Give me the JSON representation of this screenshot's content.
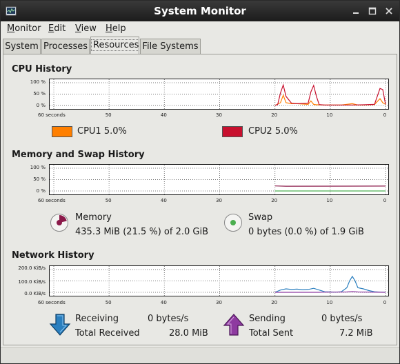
{
  "window": {
    "title": "System Monitor"
  },
  "menu": [
    "Monitor",
    "Edit",
    "View",
    "Help"
  ],
  "tabs": [
    "System",
    "Processes",
    "Resources",
    "File Systems"
  ],
  "active_tab": "Resources",
  "sections": {
    "cpu": {
      "title": "CPU History"
    },
    "memory": {
      "title": "Memory and Swap History"
    },
    "network": {
      "title": "Network History"
    }
  },
  "x_labels": [
    "60 seconds",
    "50",
    "40",
    "30",
    "20",
    "10",
    "0"
  ],
  "percent_labels": [
    "100 %",
    "50 %",
    "0 %"
  ],
  "network_labels": [
    "200.0 KiB/s",
    "100.0 KiB/s",
    "0.0 KiB/s"
  ],
  "cpu_legend": [
    {
      "label": "CPU1",
      "value": "5.0%",
      "color": "#ff7f00"
    },
    {
      "label": "CPU2",
      "value": "5.0%",
      "color": "#c8102e"
    }
  ],
  "memory_info": {
    "memory_label": "Memory",
    "memory_value": "435.3 MiB (21.5 %) of 2.0 GiB",
    "memory_fraction": 0.215,
    "swap_label": "Swap",
    "swap_value": "0 bytes (0.0 %) of 1.9 GiB",
    "swap_fraction": 0.0,
    "memory_color": "#8b1a4a",
    "swap_color": "#4caf50"
  },
  "network_info": {
    "receiving_label": "Receiving",
    "receiving_value": "0 bytes/s",
    "total_received_label": "Total Received",
    "total_received_value": "28.0 MiB",
    "sending_label": "Sending",
    "sending_value": "0 bytes/s",
    "total_sent_label": "Total Sent",
    "total_sent_value": "7.2 MiB",
    "receiving_color": "#2a7fbf",
    "sending_color": "#8e3aa0"
  },
  "chart_data": [
    {
      "type": "line",
      "xlim": [
        -60,
        0
      ],
      "ylim": [
        0,
        100
      ],
      "series": [
        {
          "name": "CPU1",
          "color": "#ff7f00",
          "x": [
            -20,
            -19,
            -18.5,
            -18,
            -17,
            -16,
            -14,
            -13.5,
            -13,
            -12.5,
            -12,
            -11,
            -8,
            -6,
            -5,
            -4,
            -2,
            -1,
            -0.5,
            0
          ],
          "y": [
            0,
            12,
            45,
            12,
            8,
            8,
            5,
            20,
            5,
            3,
            3,
            2,
            2,
            8,
            2,
            2,
            4,
            30,
            12,
            5
          ]
        },
        {
          "name": "CPU2",
          "color": "#c8102e",
          "x": [
            -20,
            -19.5,
            -19,
            -18.5,
            -18,
            -17,
            -16,
            -14,
            -13.5,
            -13,
            -12.5,
            -12,
            -11,
            -6,
            -4,
            -2,
            -1,
            -0.5,
            0
          ],
          "y": [
            0,
            5,
            55,
            90,
            40,
            10,
            8,
            10,
            60,
            88,
            40,
            4,
            2,
            2,
            3,
            5,
            75,
            70,
            5
          ]
        }
      ]
    },
    {
      "type": "line",
      "xlim": [
        -60,
        0
      ],
      "ylim": [
        0,
        100
      ],
      "series": [
        {
          "name": "Memory",
          "color": "#8b1a4a",
          "x": [
            -20,
            -18,
            0
          ],
          "y": [
            22,
            21,
            21.5
          ]
        },
        {
          "name": "Swap",
          "color": "#4caf50",
          "x": [
            -20,
            0
          ],
          "y": [
            0,
            0
          ]
        }
      ]
    },
    {
      "type": "line",
      "xlim": [
        -60,
        0
      ],
      "ylim": [
        0,
        200
      ],
      "series": [
        {
          "name": "Receiving",
          "color": "#2a7fbf",
          "x": [
            -20,
            -19,
            -18,
            -17,
            -16,
            -15,
            -14,
            -13,
            -12,
            -11,
            -10,
            -9,
            -8,
            -7,
            -6.5,
            -6,
            -5.5,
            -5,
            -4,
            -3,
            -2,
            -1,
            0
          ],
          "y": [
            0,
            20,
            30,
            25,
            28,
            22,
            25,
            35,
            20,
            5,
            3,
            2,
            5,
            40,
            100,
            140,
            100,
            40,
            30,
            15,
            5,
            2,
            0
          ]
        },
        {
          "name": "Sending",
          "color": "#8e3aa0",
          "x": [
            -20,
            -12,
            -11,
            -10,
            -7,
            -6,
            -5,
            0
          ],
          "y": [
            0,
            0,
            2,
            1,
            3,
            6,
            3,
            0
          ]
        }
      ]
    }
  ]
}
